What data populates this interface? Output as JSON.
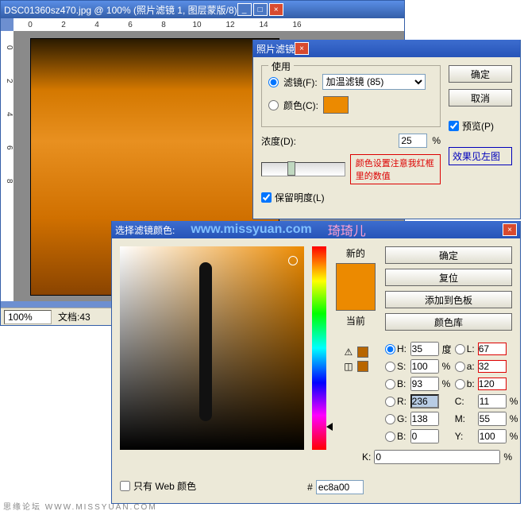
{
  "main": {
    "title": "DSC01360sz470.jpg @ 100% (照片滤镜 1, 图层蒙版/8)",
    "ruler_h": [
      "0",
      "2",
      "4",
      "6",
      "8",
      "10",
      "12",
      "14",
      "16"
    ],
    "ruler_v": [
      "0",
      "2",
      "4",
      "6",
      "8"
    ],
    "zoom": "100%",
    "doc_label": "文档:43"
  },
  "photo_filter": {
    "title": "照片滤镜",
    "group": "使用",
    "filter_label": "滤镜(F):",
    "filter_value": "加温滤镜 (85)",
    "color_label": "颜色(C):",
    "density_label": "浓度(D):",
    "density_value": "25",
    "percent": "%",
    "preserve": "保留明度(L)",
    "ok": "确定",
    "cancel": "取消",
    "preview": "预览(P)",
    "hint_right": "效果见左图",
    "hint_bottom": "颜色设置注意我红框里的数值"
  },
  "color_picker": {
    "title": "选择滤镜颜色:",
    "watermark": "www.missyuan.com",
    "author": "琦琦儿",
    "new": "新的",
    "current": "当前",
    "ok": "确定",
    "reset": "复位",
    "add": "添加到色板",
    "lib": "颜色库",
    "web_only": "只有 Web 颜色",
    "hex_label": "#",
    "hex": "ec8a00",
    "H": {
      "label": "H:",
      "val": "35",
      "unit": "度"
    },
    "S": {
      "label": "S:",
      "val": "100",
      "unit": "%"
    },
    "Bv": {
      "label": "B:",
      "val": "93",
      "unit": "%"
    },
    "R": {
      "label": "R:",
      "val": "236"
    },
    "G": {
      "label": "G:",
      "val": "138"
    },
    "B2": {
      "label": "B:",
      "val": "0"
    },
    "L": {
      "label": "L:",
      "val": "67"
    },
    "a": {
      "label": "a:",
      "val": "32"
    },
    "b": {
      "label": "b:",
      "val": "120"
    },
    "C": {
      "label": "C:",
      "val": "11",
      "unit": "%"
    },
    "M": {
      "label": "M:",
      "val": "55",
      "unit": "%"
    },
    "Y": {
      "label": "Y:",
      "val": "100",
      "unit": "%"
    },
    "K": {
      "label": "K:",
      "val": "0",
      "unit": "%"
    }
  },
  "footer": "思缘论坛  WWW.MISSYUAN.COM"
}
